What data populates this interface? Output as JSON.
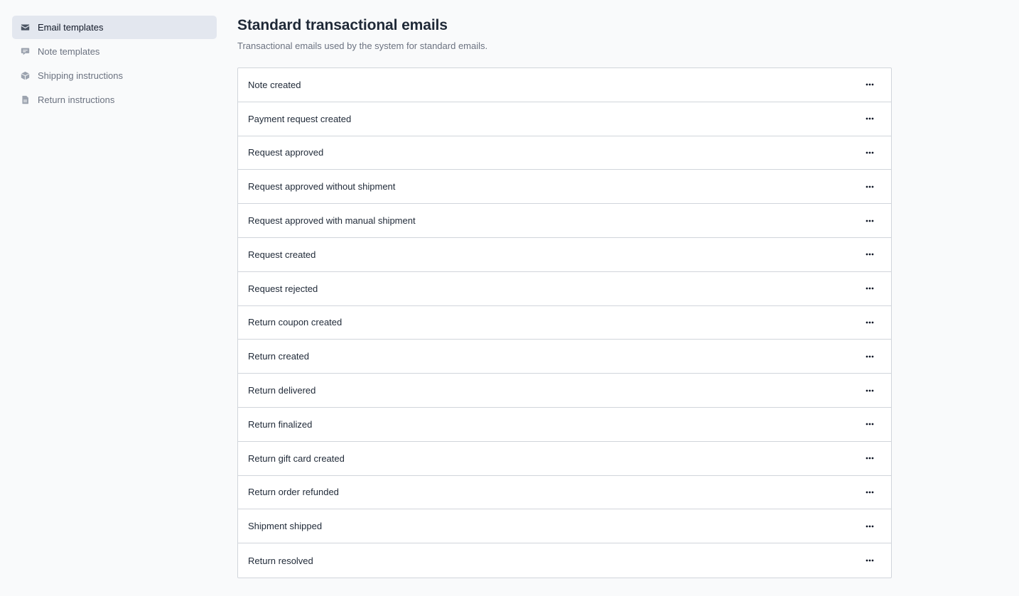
{
  "sidebar": {
    "items": [
      {
        "label": "Email templates",
        "icon": "envelope-icon",
        "active": true
      },
      {
        "label": "Note templates",
        "icon": "chat-bubble-icon",
        "active": false
      },
      {
        "label": "Shipping instructions",
        "icon": "cube-icon",
        "active": false
      },
      {
        "label": "Return instructions",
        "icon": "document-icon",
        "active": false
      }
    ]
  },
  "main": {
    "title": "Standard transactional emails",
    "subtitle": "Transactional emails used by the system for standard emails.",
    "templates": [
      {
        "name": "Note created"
      },
      {
        "name": "Payment request created"
      },
      {
        "name": "Request approved"
      },
      {
        "name": "Request approved without shipment"
      },
      {
        "name": "Request approved with manual shipment"
      },
      {
        "name": "Request created"
      },
      {
        "name": "Request rejected"
      },
      {
        "name": "Return coupon created"
      },
      {
        "name": "Return created"
      },
      {
        "name": "Return delivered"
      },
      {
        "name": "Return finalized"
      },
      {
        "name": "Return gift card created"
      },
      {
        "name": "Return order refunded"
      },
      {
        "name": "Shipment shipped"
      },
      {
        "name": "Return resolved"
      }
    ],
    "row_menu_icon": "more-horizontal-icon"
  }
}
